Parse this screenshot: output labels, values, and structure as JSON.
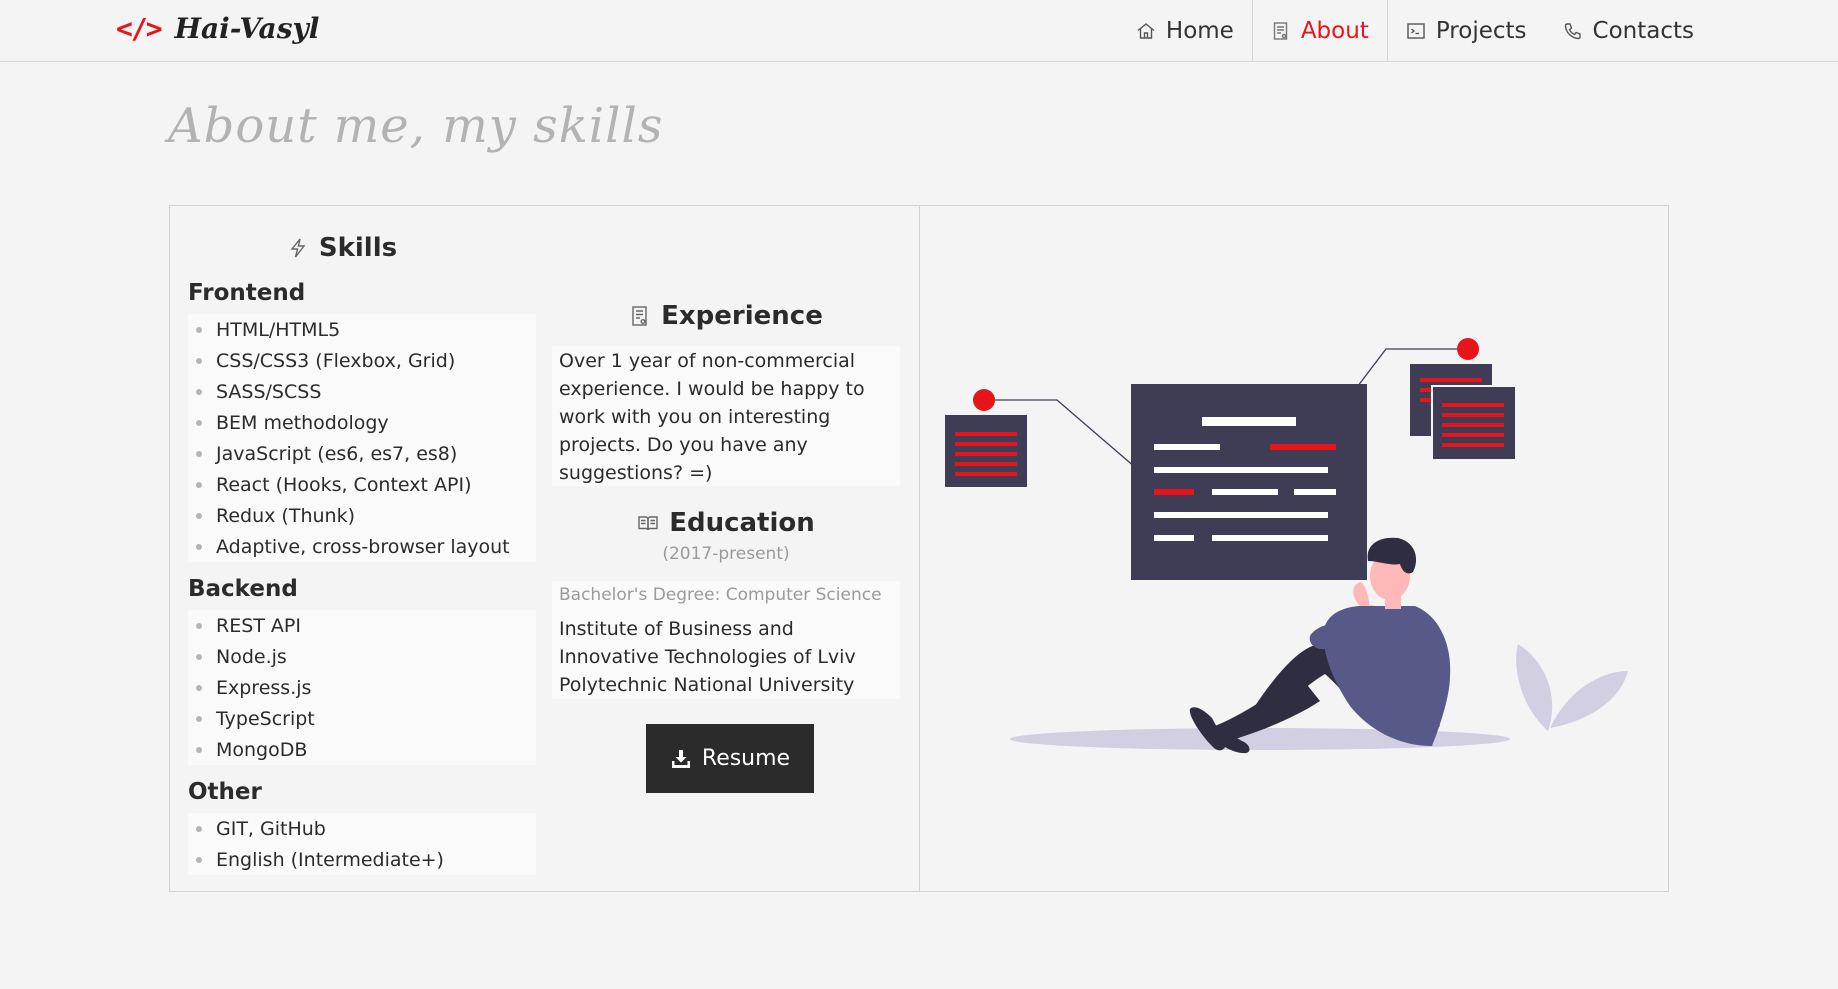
{
  "brand": {
    "logo_symbol": "</>",
    "name": "Hai-Vasyl",
    "accent": "#e8141b"
  },
  "nav": {
    "items": [
      {
        "label": "Home",
        "icon": "home-icon"
      },
      {
        "label": "About",
        "icon": "document-icon",
        "active": true
      },
      {
        "label": "Projects",
        "icon": "terminal-icon"
      },
      {
        "label": "Contacts",
        "icon": "phone-icon"
      }
    ]
  },
  "page": {
    "title": "About me, my skills"
  },
  "skills": {
    "heading": "Skills",
    "groups": [
      {
        "title": "Frontend",
        "items": [
          "HTML/HTML5",
          "CSS/CSS3 (Flexbox, Grid)",
          "SASS/SCSS",
          "BEM methodology",
          "JavaScript (es6, es7, es8)",
          "React (Hooks, Context API)",
          "Redux (Thunk)",
          "Adaptive, cross-browser layout"
        ]
      },
      {
        "title": "Backend",
        "items": [
          "REST API",
          "Node.js",
          "Express.js",
          "TypeScript",
          "MongoDB"
        ]
      },
      {
        "title": "Other",
        "items": [
          "GIT, GitHub",
          "English (Intermediate+)"
        ]
      }
    ]
  },
  "experience": {
    "heading": "Experience",
    "text": "Over 1 year of non-commercial experience. I would be happy to work with you on interesting projects. Do you have any suggestions? =)"
  },
  "education": {
    "heading": "Education",
    "years": "(2017-present)",
    "degree": "Bachelor's Degree: Computer Science",
    "institution": "Institute of Business and Innovative Technologies of Lviv Polytechnic National University"
  },
  "resume": {
    "label": "Resume",
    "icon": "download-icon"
  }
}
